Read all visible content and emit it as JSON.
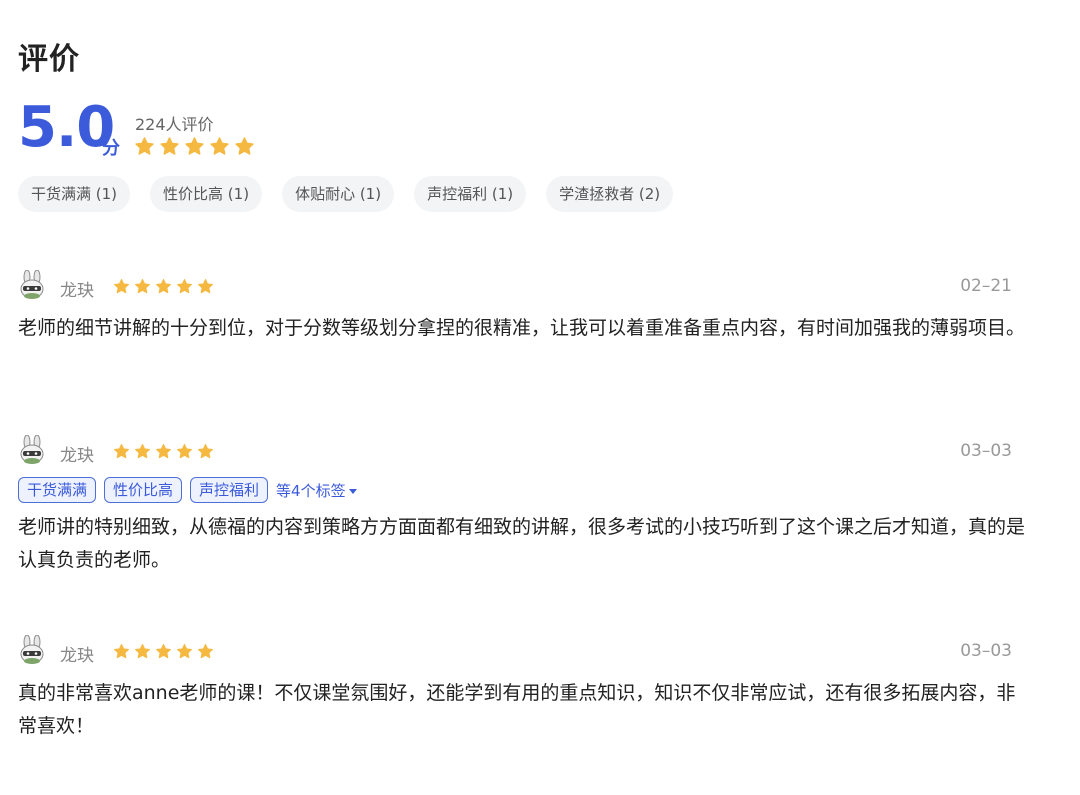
{
  "header": {
    "title": "评价",
    "score": "5.0",
    "score_unit": "分",
    "rating_count": "224人评价",
    "stars": 5
  },
  "summary_tags": [
    {
      "label": "干货满满 (1)"
    },
    {
      "label": "性价比高 (1)"
    },
    {
      "label": "体贴耐心 (1)"
    },
    {
      "label": "声控福利 (1)"
    },
    {
      "label": "学渣拯救者 (2)"
    }
  ],
  "reviews": [
    {
      "username": "龙玦",
      "stars": 5,
      "date": "02–21",
      "text": "老师的细节讲解的十分到位，对于分数等级划分拿捏的很精准，让我可以着重准备重点内容，有时间加强我的薄弱项目。"
    },
    {
      "username": "龙玦",
      "stars": 5,
      "date": "03–03",
      "tags": [
        "干货满满",
        "性价比高",
        "声控福利"
      ],
      "more_tags": "等4个标签",
      "text": "老师讲的特别细致，从德福的内容到策略方方面面都有细致的讲解，很多考试的小技巧听到了这个课之后才知道，真的是认真负责的老师。"
    },
    {
      "username": "龙玦",
      "stars": 5,
      "date": "03–03",
      "text": "真的非常喜欢anne老师的课！不仅课堂氛围好，还能学到有用的重点知识，知识不仅非常应试，还有很多拓展内容，非常喜欢！"
    }
  ],
  "colors": {
    "accent": "#3b5bdb",
    "star": "#f5b942",
    "tag_bg": "#f3f4f6"
  },
  "icons": {
    "star": "star-icon",
    "avatar": "rabbit-avatar-icon",
    "caret": "caret-down-icon"
  }
}
